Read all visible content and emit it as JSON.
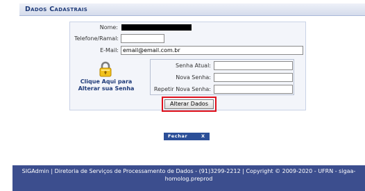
{
  "header": {
    "title": "Dados Cadastrais"
  },
  "form": {
    "nome_label": "Nome:",
    "telefone_label": "Telefone/Ramal:",
    "telefone_value": "",
    "email_label": "E-Mail:",
    "email_value": "email@email.com.br",
    "change_password_link": "Clique Aqui para Alterar sua Senha",
    "senha_atual_label": "Senha Atual:",
    "nova_senha_label": "Nova Senha:",
    "repetir_label": "Repetir Nova Senha:",
    "alterar_button": "Alterar Dados"
  },
  "actions": {
    "fechar_label": "Fechar",
    "fechar_x": "X"
  },
  "footer": {
    "text": "SIGAdmin | Diretoria de Serviços de Processamento de Dados - (91)3299-2212 | Copyright © 2009-2020 - UFRN - sigaa-homolog.preprod"
  },
  "colors": {
    "header_text": "#1e3a78",
    "footer_bg": "#3c4e8e",
    "highlight": "#e0101b",
    "fechar_bg": "#2b4f98"
  },
  "icons": {
    "lock": "lock-icon"
  }
}
